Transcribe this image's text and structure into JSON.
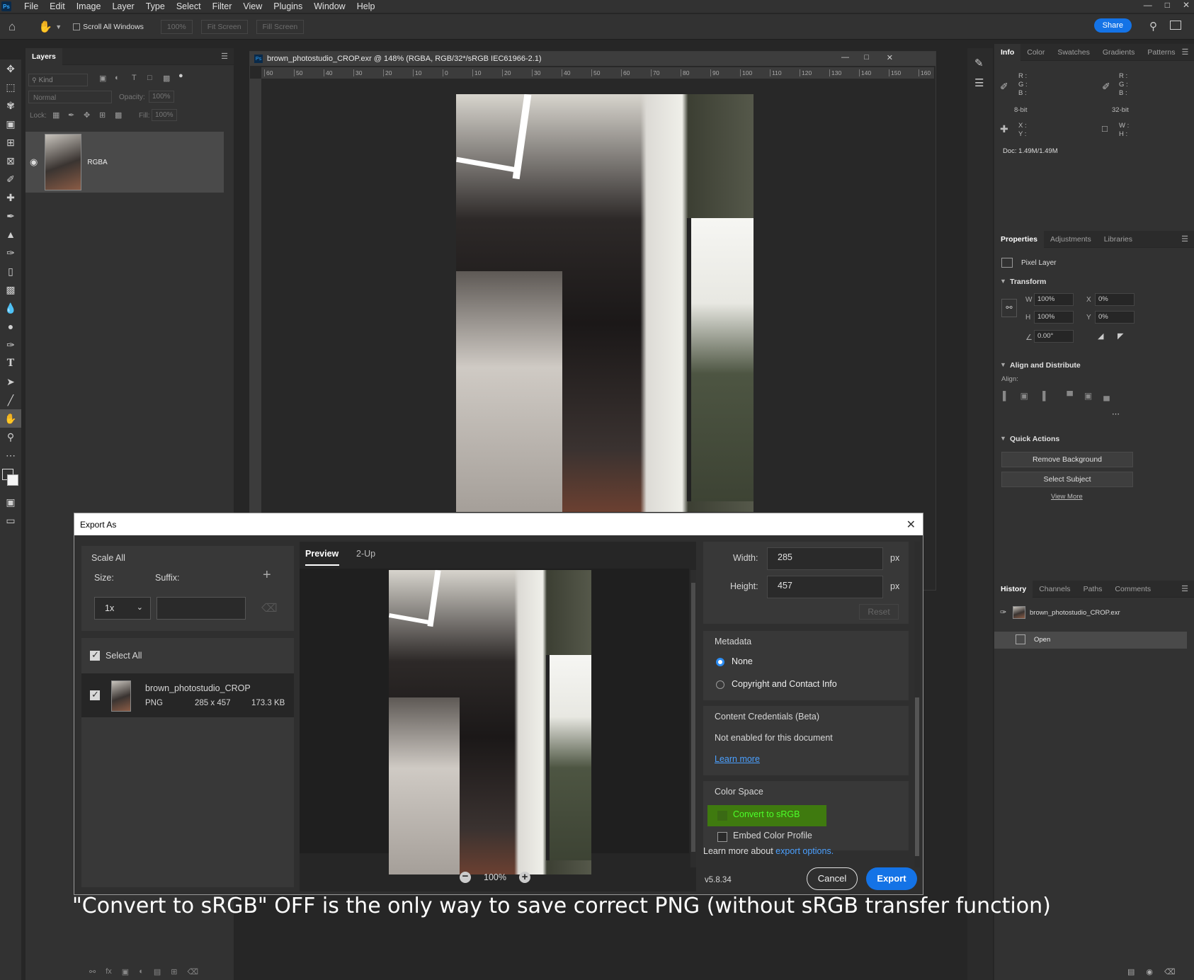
{
  "app": {
    "logo": "Ps",
    "menu": [
      "File",
      "Edit",
      "Image",
      "Layer",
      "Type",
      "Select",
      "Filter",
      "View",
      "Plugins",
      "Window",
      "Help"
    ]
  },
  "options_bar": {
    "scroll_all_windows": "Scroll All Windows",
    "zoom_value": "100%",
    "fit_screen": "Fit Screen",
    "fill_screen": "Fill Screen",
    "share": "Share"
  },
  "layers_panel": {
    "tab": "Layers",
    "kind_filter": "Kind",
    "blend_mode": "Normal",
    "opacity_label": "Opacity:",
    "opacity_value": "100%",
    "lock_label": "Lock:",
    "fill_label": "Fill:",
    "fill_value": "100%",
    "layer_name": "RGBA"
  },
  "document": {
    "title": "brown_photostudio_CROP.exr @ 148% (RGBA, RGB/32*/sRGB IEC61966-2.1)",
    "ruler_ticks": [
      "60",
      "50",
      "40",
      "30",
      "20",
      "10",
      "0",
      "10",
      "20",
      "30",
      "40",
      "50",
      "60",
      "70",
      "80",
      "90",
      "100",
      "110",
      "120",
      "130",
      "140",
      "150",
      "160"
    ]
  },
  "info_panel": {
    "tabs": [
      "Info",
      "Color",
      "Swatches",
      "Gradients",
      "Patterns"
    ],
    "r": "R :",
    "g": "G :",
    "b": "B :",
    "bit8": "8-bit",
    "bit32": "32-bit",
    "x": "X :",
    "y": "Y :",
    "w": "W :",
    "h": "H :",
    "doc": "Doc: 1.49M/1.49M"
  },
  "properties_panel": {
    "tabs": [
      "Properties",
      "Adjustments",
      "Libraries"
    ],
    "layer_type": "Pixel Layer",
    "transform": "Transform",
    "w_label": "W",
    "w_value": "100%",
    "h_label": "H",
    "h_value": "100%",
    "x_label": "X",
    "x_value": "0%",
    "y_label": "Y",
    "y_value": "0%",
    "angle_value": "0.00°",
    "align_distribute": "Align and Distribute",
    "align_label": "Align:",
    "quick_actions": "Quick Actions",
    "remove_background": "Remove Background",
    "select_subject": "Select Subject",
    "view_more": "View More"
  },
  "history_panel": {
    "tabs": [
      "History",
      "Channels",
      "Paths",
      "Comments"
    ],
    "snapshot": "brown_photostudio_CROP.exr",
    "step": "Open"
  },
  "export_dialog": {
    "title": "Export As",
    "scale_all": "Scale All",
    "size_label": "Size:",
    "suffix_label": "Suffix:",
    "size_value": "1x",
    "select_all": "Select All",
    "asset_name": "brown_photostudio_CROP",
    "asset_format": "PNG",
    "asset_dims": "285 x 457",
    "asset_size": "173.3 KB",
    "tab_preview": "Preview",
    "tab_2up": "2-Up",
    "zoom": "100%",
    "width_label": "Width:",
    "width_value": "285",
    "height_label": "Height:",
    "height_value": "457",
    "px": "px",
    "reset": "Reset",
    "metadata": "Metadata",
    "meta_none": "None",
    "meta_copyright": "Copyright and Contact Info",
    "content_credentials": "Content Credentials (Beta)",
    "not_enabled": "Not enabled for this document",
    "learn_more": "Learn more",
    "color_space": "Color Space",
    "convert_srgb": "Convert to sRGB",
    "embed_profile": "Embed Color Profile",
    "learn_more_about": "Learn more about",
    "export_options": "export options.",
    "version": "v5.8.34",
    "cancel": "Cancel",
    "export": "Export"
  },
  "caption": "\"Convert to sRGB\" OFF is the only way to save correct PNG (without sRGB transfer function)",
  "colors": {
    "accent_blue": "#1473e6",
    "highlight_green": "#3f7a0f",
    "highlight_text": "#4cff2a"
  }
}
